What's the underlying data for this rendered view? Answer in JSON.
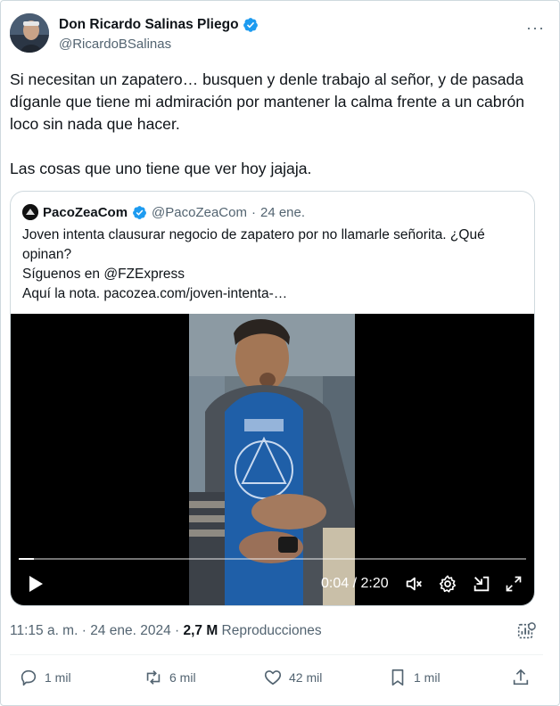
{
  "tweet": {
    "author_name": "Don Ricardo Salinas Pliego",
    "author_handle": "@RicardoBSalinas",
    "verified_icon": "verified-badge-icon",
    "more_label": "···",
    "paragraph1": "Si necesitan un zapatero… busquen y denle trabajo al señor, y de pasada díganle que tiene mi admiración por mantener la calma frente a un cabrón loco sin nada que hacer.",
    "paragraph2": "Las cosas que uno tiene que ver hoy jajaja."
  },
  "quote": {
    "author_name": "PacoZeaCom",
    "author_handle": "@PacoZeaCom",
    "separator": "·",
    "date": "24 ene.",
    "line1": "Joven intenta clausurar negocio de zapatero por no llamarle señorita. ¿Qué opinan?",
    "line2": "Síguenos en @FZExpress",
    "line3": "Aquí la nota. pacozea.com/joven-intenta-…",
    "video": {
      "current_time": "0:04",
      "time_separator": " / ",
      "duration": "2:20",
      "progress_fraction": 0.03
    }
  },
  "meta": {
    "time": "11:15 a. m.",
    "separator": " · ",
    "date": "24 ene. 2024",
    "sep2": " · ",
    "views_count": "2,7 M",
    "views_label": " Reproducciones"
  },
  "actions": {
    "replies": "1 mil",
    "retweets": "6 mil",
    "likes": "42 mil",
    "bookmarks": "1 mil"
  },
  "colors": {
    "verified": "#1d9bf0",
    "secondary_text": "#536471",
    "primary_text": "#0f1419",
    "border": "#cfd9de"
  }
}
